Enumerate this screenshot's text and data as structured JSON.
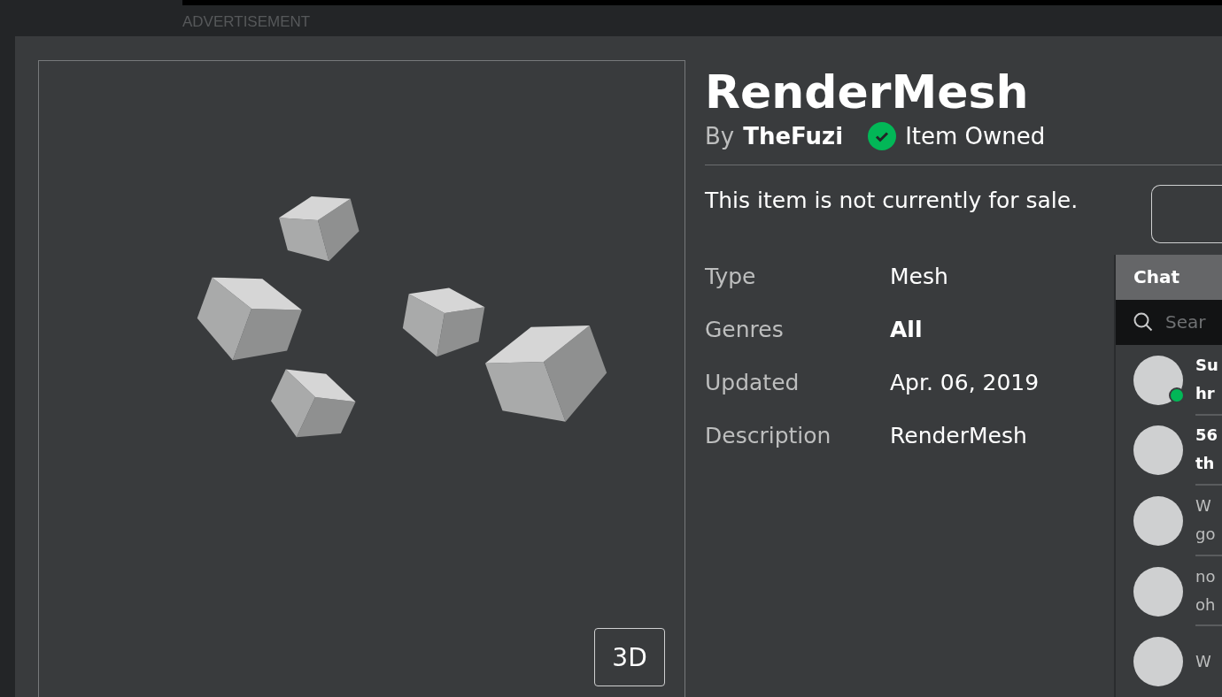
{
  "ad": {
    "label": "ADVERTISEMENT"
  },
  "item": {
    "title": "RenderMesh",
    "by_label": "By",
    "creator": "TheFuzi",
    "owned": true,
    "owned_label": "Item Owned",
    "sale_text": "This item is not currently for sale.",
    "view_button": "3D"
  },
  "details": [
    {
      "label": "Type",
      "value": "Mesh",
      "link": false
    },
    {
      "label": "Genres",
      "value": "All",
      "link": true
    },
    {
      "label": "Updated",
      "value": "Apr. 06, 2019",
      "link": false
    },
    {
      "label": "Description",
      "value": "RenderMesh",
      "link": false
    }
  ],
  "chat": {
    "title": "Chat",
    "search_placeholder": "Sear",
    "conversations": [
      {
        "line_1": "Su",
        "line_2": "hr",
        "unread": true,
        "online": true
      },
      {
        "line_1": "56",
        "line_2": "th",
        "unread": true,
        "online": false
      },
      {
        "line_1": "W",
        "line_2": "go",
        "unread": false,
        "online": false
      },
      {
        "line_1": "no",
        "line_2": "oh",
        "unread": false,
        "online": false
      },
      {
        "line_1": "W",
        "unread": false,
        "online": false
      }
    ]
  }
}
